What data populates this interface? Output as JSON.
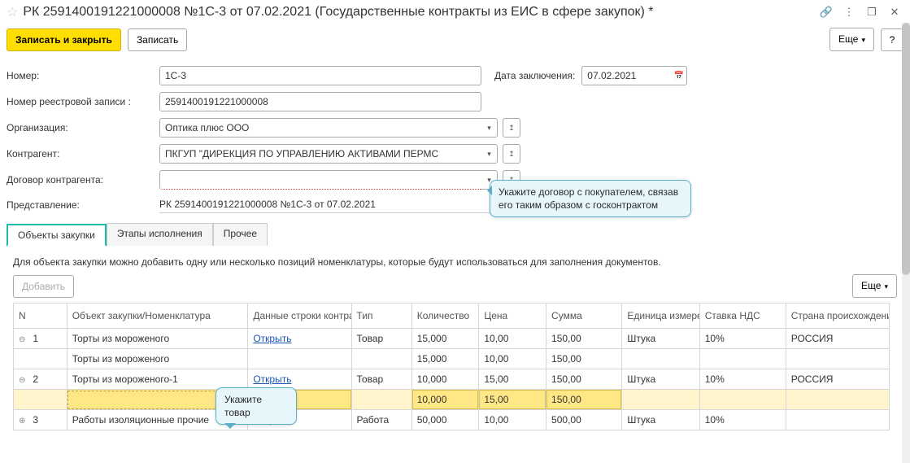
{
  "header": {
    "title": "РК 2591400191221000008 №1С-3 от 07.02.2021 (Государственные контракты из ЕИС в сфере закупок) *"
  },
  "toolbar": {
    "save_close": "Записать и закрыть",
    "save": "Записать",
    "more": "Еще",
    "help": "?"
  },
  "fields": {
    "number_label": "Номер:",
    "number_value": "1С-3",
    "date_label": "Дата заключения:",
    "date_value": "07.02.2021",
    "reg_label": "Номер реестровой записи :",
    "reg_value": "2591400191221000008",
    "org_label": "Организация:",
    "org_value": "Оптика плюс ООО",
    "kontr_label": "Контрагент:",
    "kontr_value": "ПКГУП \"ДИРЕКЦИЯ ПО УПРАВЛЕНИЮ АКТИВАМИ ПЕРМС",
    "dogovor_label": "Договор контрагента:",
    "dogovor_value": "",
    "repr_label": "Представление:",
    "repr_value": "РК 2591400191221000008 №1С-3 от 07.02.2021"
  },
  "callouts": {
    "c1": "Укажите договор с покупателем, связав его таким образом с госконтрактом",
    "c2": "Укажите товар"
  },
  "tabs": {
    "t1": "Объекты закупки",
    "t2": "Этапы исполнения",
    "t3": "Прочее"
  },
  "tab1": {
    "info": "Для объекта закупки можно добавить одну или несколько позиций номенклатуры, которые будут использоваться для заполнения документов.",
    "add": "Добавить",
    "more": "Еще",
    "cols": {
      "n": "N",
      "obj": "Объект закупки/Номенклатура",
      "data": "Данные строки контракта",
      "tip": "Тип",
      "kol": "Количество",
      "cena": "Цена",
      "sum": "Сумма",
      "ed": "Единица измерения",
      "nds": "Ставка НДС",
      "strana": "Страна происхождения"
    },
    "rows": [
      {
        "exp": "⊖",
        "n": "1",
        "obj": "Торты из мороженого",
        "data": "Открыть",
        "tip": "Товар",
        "kol": "15,000",
        "cena": "10,00",
        "sum": "150,00",
        "ed": "Штука",
        "nds": "10%",
        "strana": "РОССИЯ",
        "link": true
      },
      {
        "exp": "",
        "n": "",
        "obj": "Торты из мороженого",
        "data": "",
        "tip": "",
        "kol": "15,000",
        "cena": "10,00",
        "sum": "150,00",
        "ed": "",
        "nds": "",
        "strana": ""
      },
      {
        "exp": "⊖",
        "n": "2",
        "obj": "Торты из мороженого-1",
        "data": "Открыть",
        "tip": "Товар",
        "kol": "10,000",
        "cena": "15,00",
        "sum": "150,00",
        "ed": "Штука",
        "nds": "10%",
        "strana": "РОССИЯ",
        "link": true
      },
      {
        "exp": "",
        "n": "",
        "obj": "",
        "data": "",
        "tip": "",
        "kol": "10,000",
        "cena": "15,00",
        "sum": "150,00",
        "ed": "",
        "nds": "",
        "strana": "",
        "yellow": true
      },
      {
        "exp": "⊕",
        "n": "3",
        "obj": "Работы изоляционные прочие",
        "data": "Открыть",
        "tip": "Работа",
        "kol": "50,000",
        "cena": "10,00",
        "sum": "500,00",
        "ed": "Штука",
        "nds": "10%",
        "strana": "",
        "link": true
      }
    ]
  }
}
